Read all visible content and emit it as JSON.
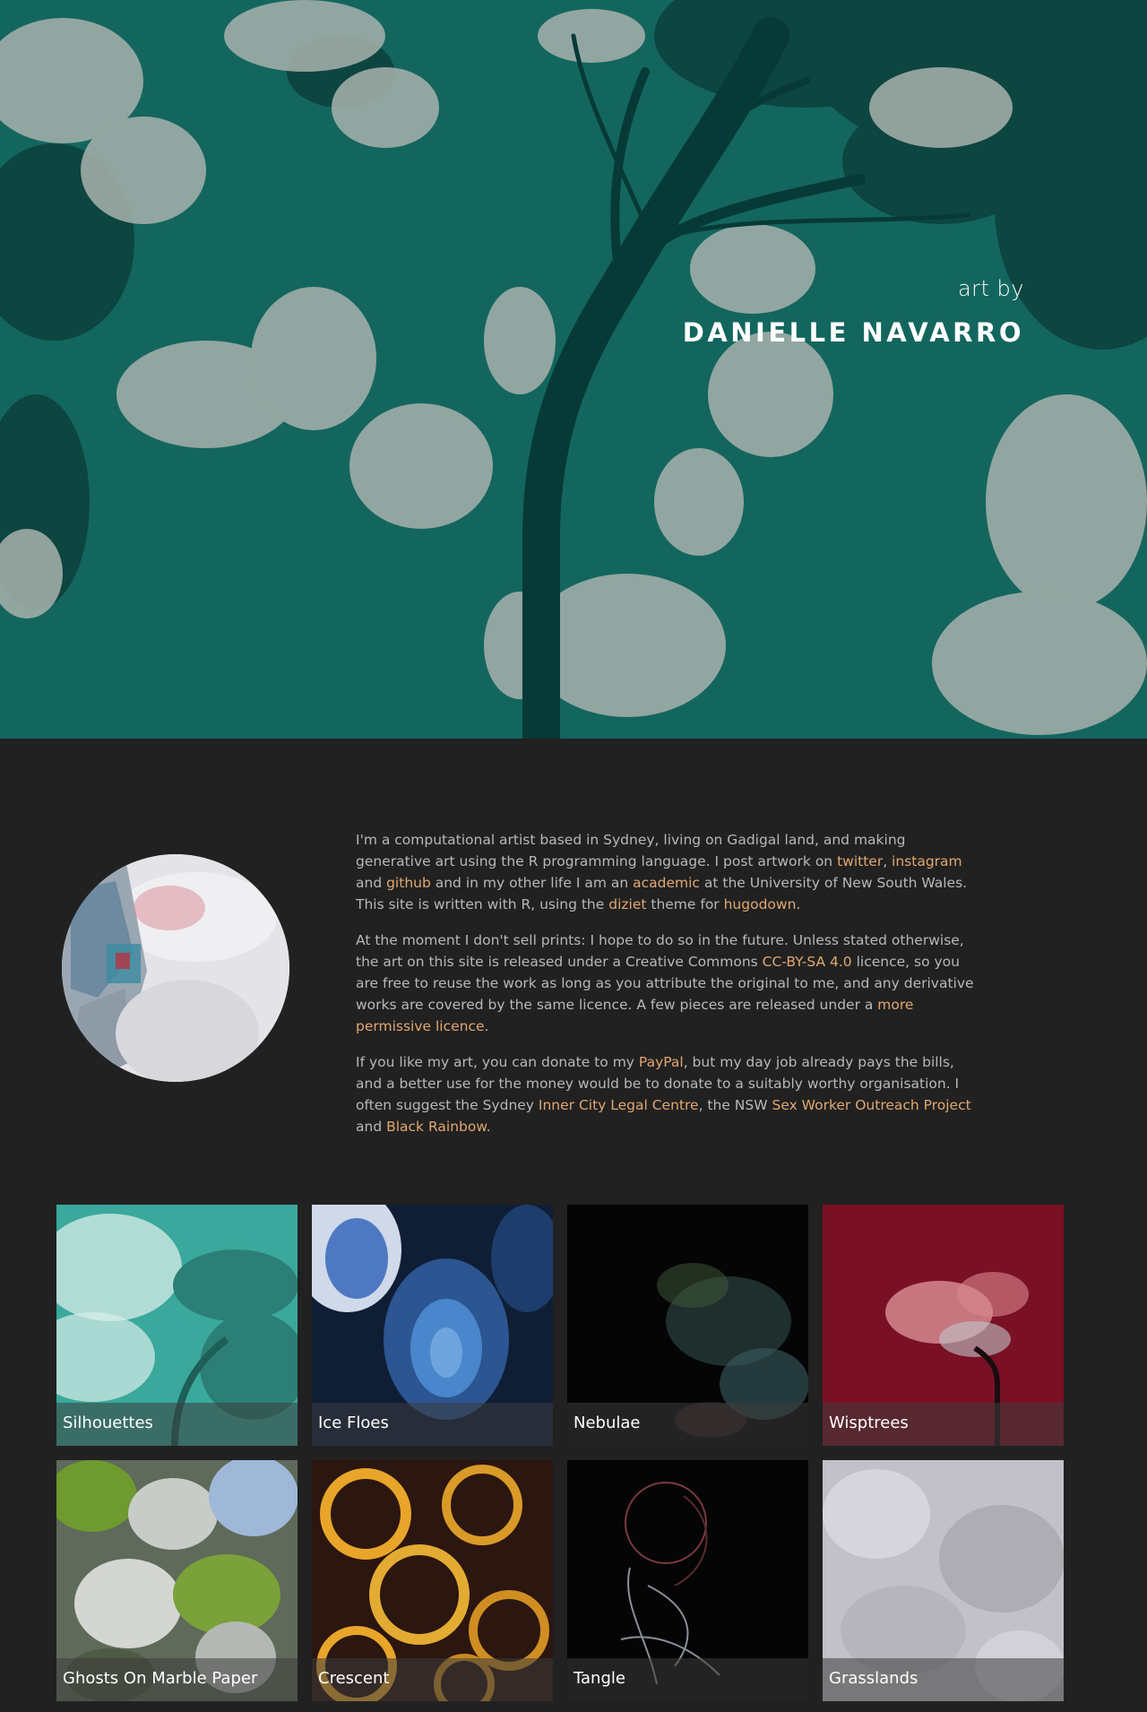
{
  "hero": {
    "subtitle": "art by",
    "title": "DANIELLE NAVARRO",
    "colors": {
      "background": "#13665e",
      "dark_foliage": "#0d4541",
      "light_foliage": "#a9b2ad",
      "trunk": "#073a37"
    }
  },
  "avatar": {
    "icon": "portrait-photo"
  },
  "bio": {
    "p1": {
      "t1": "I'm a computational artist based in Sydney, living on Gadigal land, and making generative art using the R programming language. I post artwork on ",
      "l1": "twitter",
      "t2": ", ",
      "l2": "instagram",
      "t3": " and ",
      "l3": "github",
      "t4": " and in my other life I am an ",
      "l4": "academic",
      "t5": " at the University of New South Wales. This site is written with R, using the ",
      "l5": "diziet",
      "t6": " theme for ",
      "l6": "hugodown",
      "t7": "."
    },
    "p2": {
      "t1": "At the moment I don't sell prints: I hope to do so in the future. Unless stated otherwise, the art on this site is released under a Creative Commons ",
      "l1": "CC-BY-SA 4.0",
      "t2": " licence, so you are free to reuse the work as long as you attribute the original to me, and any derivative works are covered by the same licence. A few pieces are released under a ",
      "l2": "more permissive licence",
      "t3": "."
    },
    "p3": {
      "t1": "If you like my art, you can donate to my ",
      "l1": "PayPal",
      "t2": ", but my day job already pays the bills, and a better use for the money would be to donate to a suitably worthy organisation. I often suggest the Sydney ",
      "l2": "Inner City Legal Centre",
      "t3": ", the NSW ",
      "l3": "Sex Worker Outreach Project",
      "t4": " and ",
      "l4": "Black Rainbow",
      "t5": "."
    },
    "link_color": "#e2a76f"
  },
  "gallery": [
    {
      "title": "Silhouettes"
    },
    {
      "title": "Ice Floes"
    },
    {
      "title": "Nebulae"
    },
    {
      "title": "Wisptrees"
    },
    {
      "title": "Ghosts On Marble Paper"
    },
    {
      "title": "Crescent"
    },
    {
      "title": "Tangle"
    },
    {
      "title": "Grasslands"
    }
  ]
}
